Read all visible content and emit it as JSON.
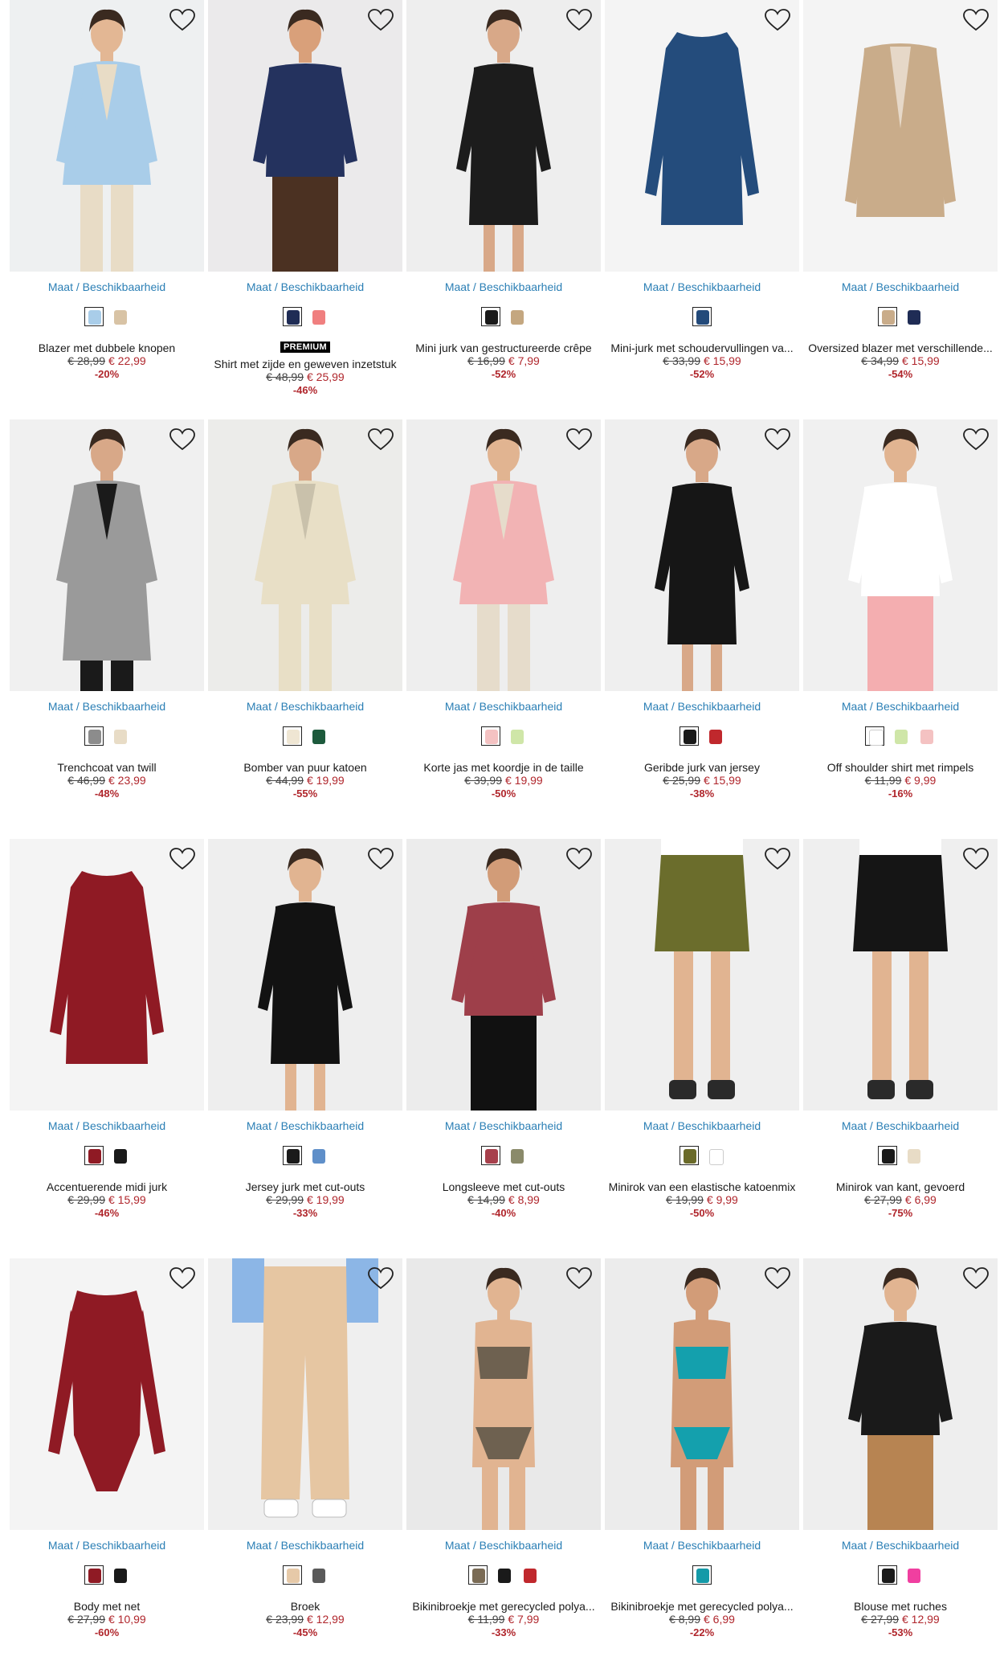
{
  "size_link": {
    "maat": "Maat",
    "sep": "/",
    "beschikbaarheid": "Beschikbaarheid"
  },
  "colors": {
    "link": "#2b7fb5",
    "sale": "#b0262c"
  },
  "icons": {
    "favorite": "heart-outline-icon"
  },
  "products": [
    {
      "name": "Blazer met dubbele knopen",
      "old_price": "€ 28,99",
      "price": "€ 22,99",
      "discount": "-20%",
      "badge": "",
      "swatches": [
        "#a9cde9",
        "#d8c3a5"
      ],
      "img": {
        "bg": "#eef0f1",
        "main": "#a9cde9",
        "second": "#e8dcc6",
        "skin": "#e3b794",
        "style": "blazer-person"
      }
    },
    {
      "name": "Shirt met zijde en geweven inzetstuk",
      "old_price": "€ 48,99",
      "price": "€ 25,99",
      "discount": "-46%",
      "badge": "PREMIUM",
      "swatches": [
        "#1f2c55",
        "#f07f7f"
      ],
      "img": {
        "bg": "#ebeaeb",
        "main": "#24325e",
        "second": "#4b3122",
        "skin": "#d9a07a",
        "style": "top-person"
      }
    },
    {
      "name": "Mini jurk van gestructureerde crêpe",
      "old_price": "€ 16,99",
      "price": "€ 7,99",
      "discount": "-52%",
      "badge": "",
      "swatches": [
        "#1a1a1a",
        "#c4a780"
      ],
      "img": {
        "bg": "#eeeeee",
        "main": "#1c1c1c",
        "second": "#1c1c1c",
        "skin": "#d8a888",
        "style": "dress-person"
      }
    },
    {
      "name": "Mini-jurk met schoudervullingen va...",
      "old_price": "€ 33,99",
      "price": "€ 15,99",
      "discount": "-52%",
      "badge": "",
      "swatches": [
        "#234a7a"
      ],
      "img": {
        "bg": "#f4f4f4",
        "main": "#244c7c",
        "second": "#244c7c",
        "skin": "",
        "style": "dress-flat"
      }
    },
    {
      "name": "Oversized blazer met verschillende...",
      "old_price": "€ 34,99",
      "price": "€ 15,99",
      "discount": "-54%",
      "badge": "",
      "swatches": [
        "#c9ac8a",
        "#1f2c55"
      ],
      "img": {
        "bg": "#f4f4f4",
        "main": "#c9ac8a",
        "second": "#c9ac8a",
        "skin": "",
        "style": "blazer-flat"
      }
    },
    {
      "name": "Trenchcoat van twill",
      "old_price": "€ 46,99",
      "price": "€ 23,99",
      "discount": "-48%",
      "badge": "",
      "swatches": [
        "#8c8c8c",
        "#e8dcc6"
      ],
      "img": {
        "bg": "#f0f0f0",
        "main": "#9a9a9a",
        "second": "#1a1a1a",
        "skin": "#d8a888",
        "style": "coat-person"
      }
    },
    {
      "name": "Bomber van puur katoen",
      "old_price": "€ 44,99",
      "price": "€ 19,99",
      "discount": "-55%",
      "badge": "",
      "swatches": [
        "#efe6d3",
        "#1d5a3c"
      ],
      "img": {
        "bg": "#ececea",
        "main": "#e8dfc6",
        "second": "#e8dfc6",
        "skin": "#d8a888",
        "style": "jacket-person"
      }
    },
    {
      "name": "Korte jas met koordje in de taille",
      "old_price": "€ 39,99",
      "price": "€ 19,99",
      "discount": "-50%",
      "badge": "",
      "swatches": [
        "#f4c2c2",
        "#cfe6a8"
      ],
      "img": {
        "bg": "#eeeeee",
        "main": "#f2b3b4",
        "second": "#e6dccb",
        "skin": "#e1b491",
        "style": "jacket-person"
      }
    },
    {
      "name": "Geribde jurk van jersey",
      "old_price": "€ 25,99",
      "price": "€ 15,99",
      "discount": "-38%",
      "badge": "",
      "swatches": [
        "#1a1a1a",
        "#c0282d"
      ],
      "img": {
        "bg": "#efefef",
        "main": "#161616",
        "second": "#161616",
        "skin": "#d8a888",
        "style": "dress-person"
      }
    },
    {
      "name": "Off shoulder shirt met rimpels",
      "old_price": "€ 11,99",
      "price": "€ 9,99",
      "discount": "-16%",
      "badge": "",
      "swatches": [
        "#ffffff",
        "#cfe6a8",
        "#f4c2c2"
      ],
      "img": {
        "bg": "#f0f0f0",
        "main": "#ffffff",
        "second": "#f4aeb0",
        "skin": "#e1b491",
        "style": "top-person"
      }
    },
    {
      "name": "Accentuerende midi jurk",
      "old_price": "€ 29,99",
      "price": "€ 15,99",
      "discount": "-46%",
      "badge": "",
      "swatches": [
        "#8f1a24",
        "#1a1a1a"
      ],
      "img": {
        "bg": "#f4f4f4",
        "main": "#8f1a24",
        "second": "#8f1a24",
        "skin": "",
        "style": "dress-flat"
      }
    },
    {
      "name": "Jersey jurk met cut-outs",
      "old_price": "€ 29,99",
      "price": "€ 19,99",
      "discount": "-33%",
      "badge": "",
      "swatches": [
        "#1a1a1a",
        "#5f8fc9"
      ],
      "img": {
        "bg": "#eeeeee",
        "main": "#121212",
        "second": "#121212",
        "skin": "#e1b491",
        "style": "dress-person"
      }
    },
    {
      "name": "Longsleeve met cut-outs",
      "old_price": "€ 14,99",
      "price": "€ 8,99",
      "discount": "-40%",
      "badge": "",
      "swatches": [
        "#a7404c",
        "#8a8a6a"
      ],
      "img": {
        "bg": "#ececec",
        "main": "#9e3f4a",
        "second": "#111111",
        "skin": "#d29c78",
        "style": "top-person"
      }
    },
    {
      "name": "Minirok van een elastische katoenmix",
      "old_price": "€ 19,99",
      "price": "€ 9,99",
      "discount": "-50%",
      "badge": "",
      "swatches": [
        "#6b6b2a",
        "#ffffff"
      ],
      "img": {
        "bg": "#efefef",
        "main": "#6b6d2c",
        "second": "#6b6d2c",
        "skin": "#e1b491",
        "style": "skirt-legs"
      }
    },
    {
      "name": "Minirok van kant, gevoerd",
      "old_price": "€ 27,99",
      "price": "€ 6,99",
      "discount": "-75%",
      "badge": "",
      "swatches": [
        "#1a1a1a",
        "#e8dcc6"
      ],
      "img": {
        "bg": "#efefef",
        "main": "#151515",
        "second": "#151515",
        "skin": "#e1b491",
        "style": "skirt-legs"
      }
    },
    {
      "name": "Body met net",
      "old_price": "€ 27,99",
      "price": "€ 10,99",
      "discount": "-60%",
      "badge": "",
      "swatches": [
        "#8f1a24",
        "#1a1a1a"
      ],
      "img": {
        "bg": "#f4f4f4",
        "main": "#8f1a24",
        "second": "#8f1a24",
        "skin": "",
        "style": "body-flat"
      }
    },
    {
      "name": "Broek",
      "old_price": "€ 23,99",
      "price": "€ 12,99",
      "discount": "-45%",
      "badge": "",
      "swatches": [
        "#e6c9a8",
        "#5a5a5a"
      ],
      "img": {
        "bg": "#efefef",
        "main": "#e6c6a2",
        "second": "#8cb6e6",
        "skin": "",
        "style": "pants-legs"
      }
    },
    {
      "name": "Bikinibroekje met gerecycled polya...",
      "old_price": "€ 11,99",
      "price": "€ 7,99",
      "discount": "-33%",
      "badge": "",
      "swatches": [
        "#7a6b55",
        "#1a1a1a",
        "#c0282d"
      ],
      "img": {
        "bg": "#e9e9e9",
        "main": "#6e6150",
        "second": "#6e6150",
        "skin": "#e1b491",
        "style": "bikini-person"
      }
    },
    {
      "name": "Bikinibroekje met gerecycled polya...",
      "old_price": "€ 8,99",
      "price": "€ 6,99",
      "discount": "-22%",
      "badge": "",
      "swatches": [
        "#149aa8"
      ],
      "img": {
        "bg": "#ececec",
        "main": "#14a0ad",
        "second": "#14a0ad",
        "skin": "#d29c78",
        "style": "bikini-person"
      }
    },
    {
      "name": "Blouse met ruches",
      "old_price": "€ 27,99",
      "price": "€ 12,99",
      "discount": "-53%",
      "badge": "",
      "swatches": [
        "#1a1a1a",
        "#f03fa0"
      ],
      "img": {
        "bg": "#eeeeee",
        "main": "#1a1a1a",
        "second": "#b78452",
        "skin": "#e1b491",
        "style": "top-person"
      }
    }
  ]
}
